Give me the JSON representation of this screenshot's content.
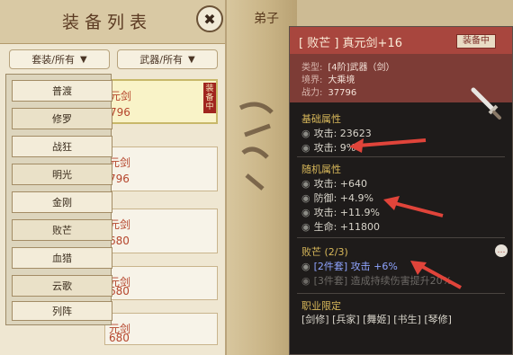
{
  "background": {
    "title": "弟子"
  },
  "equip_panel": {
    "title": "装备列表",
    "close_label": "✖",
    "filters": {
      "set_filter": "套装/所有",
      "weapon_filter": "武器/所有"
    },
    "items": [
      {
        "name": "元剑",
        "power": "796"
      },
      {
        "name": "元剑",
        "power": "796"
      },
      {
        "name": "元剑",
        "power": "680"
      },
      {
        "name": "元剑",
        "power": "680"
      },
      {
        "name": "元剑",
        "power": "680"
      }
    ],
    "equipped_tag": "装备中",
    "set_options": [
      "普渡",
      "修罗",
      "战狂",
      "明光",
      "金刚",
      "败芒",
      "血猎",
      "云歌",
      "列阵"
    ]
  },
  "detail": {
    "name": "[ 败芒 ] 真元剑+16",
    "equipped_badge": "装备中",
    "info": {
      "type_label": "类型:",
      "type_value": "[4阶]武器（剑）",
      "realm_label": "境界:",
      "realm_value": "大乘境",
      "power_label": "战力:",
      "power_value": "37796"
    },
    "base_title": "基础属性",
    "base_stats": [
      "攻击: 23623",
      "攻击: 9%"
    ],
    "random_title": "随机属性",
    "random_stats": [
      "攻击: +640",
      "防御: +4.9%",
      "攻击: +11.9%",
      "生命: +11800"
    ],
    "set_title": "败芒 (2/3)",
    "set_bonus_active": "[2件套] 攻击 +6%",
    "set_bonus_inactive": "[3件套] 造成持续伤害提升20%",
    "career_title": "职业限定",
    "careers": "[剑修] [兵家] [舞姬] [书生] [琴修]",
    "chat_icon": "…"
  },
  "colors": {
    "header_red": "#a8463e",
    "tooltip_bg": "#1e1b1a",
    "section_gold": "#d8b85a",
    "set_active_blue": "#8fa4ff",
    "pointer_red": "#e0443a"
  }
}
